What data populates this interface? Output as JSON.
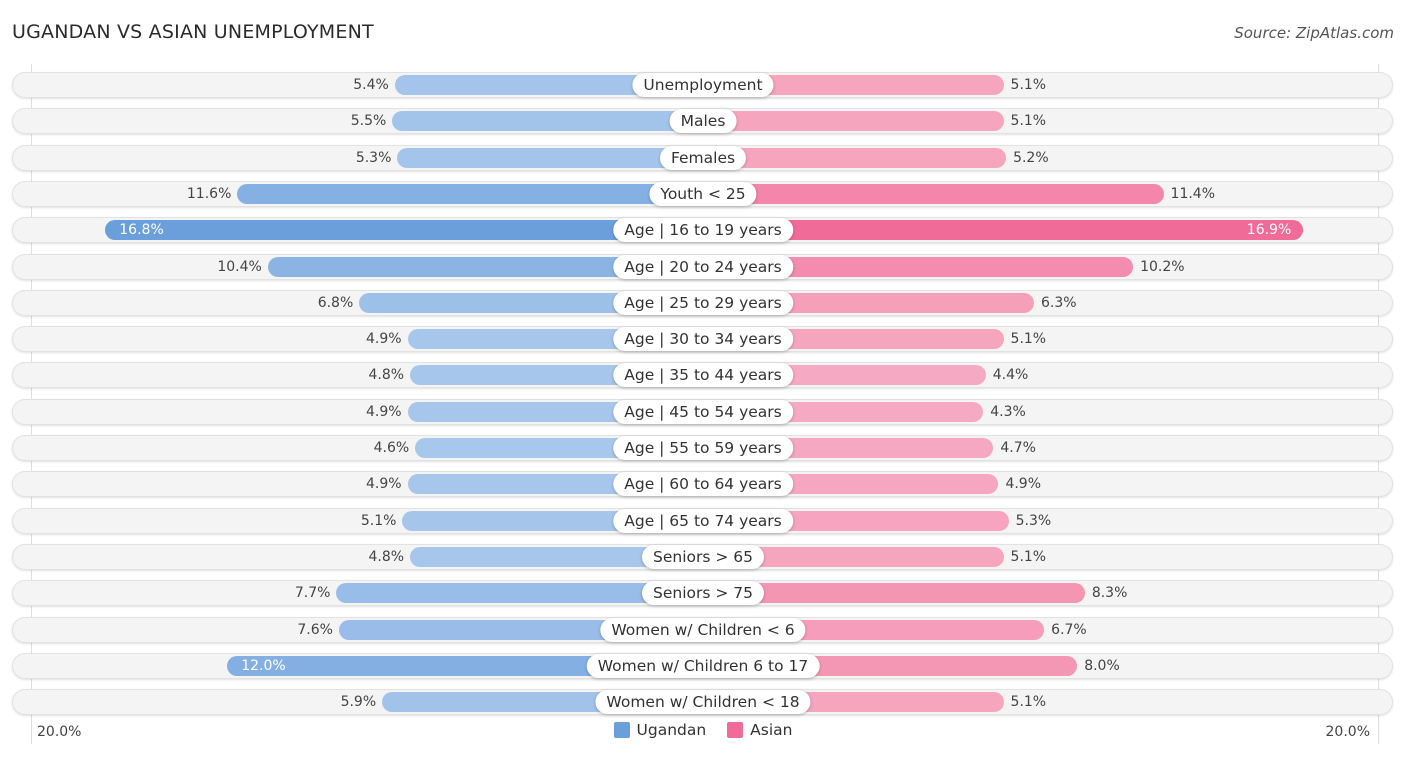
{
  "header": {
    "title": "UGANDAN VS ASIAN UNEMPLOYMENT",
    "source": "Source: ZipAtlas.com"
  },
  "colors": {
    "ugandan_strong": "#6a9fdc",
    "ugandan_light": "#a9c8ec",
    "asian_strong": "#f06b97",
    "asian_light": "#f6a9c2"
  },
  "chart_data": {
    "type": "bar",
    "orientation": "horizontal-diverging",
    "title": "UGANDAN VS ASIAN UNEMPLOYMENT",
    "source": "Source: ZipAtlas.com",
    "xlim": [
      0,
      20
    ],
    "axis_min_label": "20.0%",
    "axis_max_label": "20.0%",
    "legend_position": "bottom-center",
    "categories": [
      "Unemployment",
      "Males",
      "Females",
      "Youth < 25",
      "Age | 16 to 19 years",
      "Age | 20 to 24 years",
      "Age | 25 to 29 years",
      "Age | 30 to 34 years",
      "Age | 35 to 44 years",
      "Age | 45 to 54 years",
      "Age | 55 to 59 years",
      "Age | 60 to 64 years",
      "Age | 65 to 74 years",
      "Seniors > 65",
      "Seniors > 75",
      "Women w/ Children < 6",
      "Women w/ Children 6 to 17",
      "Women w/ Children < 18"
    ],
    "series": [
      {
        "name": "Ugandan",
        "side": "left",
        "values": [
          5.4,
          5.5,
          5.3,
          11.6,
          16.8,
          10.4,
          6.8,
          4.9,
          4.8,
          4.9,
          4.6,
          4.9,
          5.1,
          4.8,
          7.7,
          7.6,
          12.0,
          5.9
        ],
        "labels": [
          "5.4%",
          "5.5%",
          "5.3%",
          "11.6%",
          "16.8%",
          "10.4%",
          "6.8%",
          "4.9%",
          "4.8%",
          "4.9%",
          "4.6%",
          "4.9%",
          "5.1%",
          "4.8%",
          "7.7%",
          "7.6%",
          "12.0%",
          "5.9%"
        ]
      },
      {
        "name": "Asian",
        "side": "right",
        "values": [
          5.1,
          5.1,
          5.2,
          11.4,
          16.9,
          10.2,
          6.3,
          5.1,
          4.4,
          4.3,
          4.7,
          4.9,
          5.3,
          5.1,
          8.3,
          6.7,
          8.0,
          5.1
        ],
        "labels": [
          "5.1%",
          "5.1%",
          "5.2%",
          "11.4%",
          "16.9%",
          "10.2%",
          "6.3%",
          "5.1%",
          "4.4%",
          "4.3%",
          "4.7%",
          "4.9%",
          "5.3%",
          "5.1%",
          "8.3%",
          "6.7%",
          "8.0%",
          "5.1%"
        ]
      }
    ],
    "inside_label_rows": {
      "Ugandan": [
        4,
        16
      ],
      "Asian": [
        4
      ]
    }
  },
  "legend": {
    "items": [
      {
        "label": "Ugandan"
      },
      {
        "label": "Asian"
      }
    ]
  }
}
